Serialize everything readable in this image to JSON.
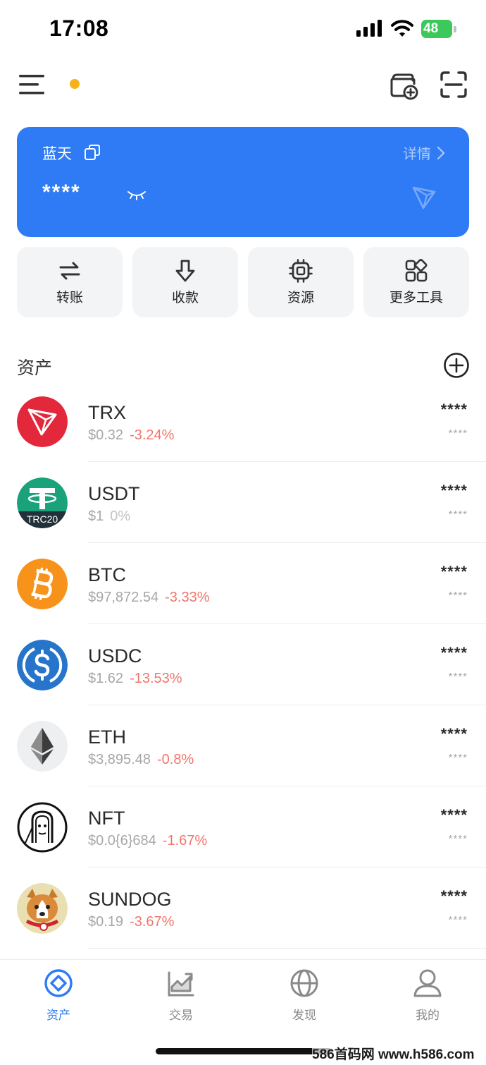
{
  "status_bar": {
    "time": "17:08",
    "battery": "48",
    "icons": [
      "cellular-signal-icon",
      "wifi-icon",
      "battery-charging-icon"
    ]
  },
  "top_bar": {
    "icons": [
      "menu-icon",
      "add-wallet-icon",
      "scan-icon"
    ],
    "dot_color": "#f5b21a"
  },
  "wallet": {
    "name": "蓝天",
    "detail_label": "详情",
    "balance": "****",
    "card_color": "#2f7bf5"
  },
  "actions": [
    {
      "label": "转账",
      "icon": "transfer-icon"
    },
    {
      "label": "收款",
      "icon": "receive-icon"
    },
    {
      "label": "资源",
      "icon": "resource-chip-icon"
    },
    {
      "label": "更多工具",
      "icon": "more-tools-icon"
    }
  ],
  "assets": {
    "title": "资产",
    "items": [
      {
        "symbol": "TRX",
        "price": "$0.32",
        "change": "-3.24%",
        "amount": "****",
        "value": "****",
        "logo": "trx-logo"
      },
      {
        "symbol": "USDT",
        "price": "$1",
        "change": "0%",
        "amount": "****",
        "value": "****",
        "logo": "usdt-logo",
        "badge": "TRC20"
      },
      {
        "symbol": "BTC",
        "price": "$97,872.54",
        "change": "-3.33%",
        "amount": "****",
        "value": "****",
        "logo": "btc-logo"
      },
      {
        "symbol": "USDC",
        "price": "$1.62",
        "change": "-13.53%",
        "amount": "****",
        "value": "****",
        "logo": "usdc-logo"
      },
      {
        "symbol": "ETH",
        "price": "$3,895.48",
        "change": "-0.8%",
        "amount": "****",
        "value": "****",
        "logo": "eth-logo"
      },
      {
        "symbol": "NFT",
        "price": "$0.0{6}684",
        "change": "-1.67%",
        "amount": "****",
        "value": "****",
        "logo": "nft-logo"
      },
      {
        "symbol": "SUNDOG",
        "price": "$0.19",
        "change": "-3.67%",
        "amount": "****",
        "value": "****",
        "logo": "sundog-logo"
      }
    ]
  },
  "bottom_nav": [
    {
      "label": "资产",
      "icon": "assets-icon",
      "active": true
    },
    {
      "label": "交易",
      "icon": "trade-chart-icon",
      "active": false
    },
    {
      "label": "发现",
      "icon": "globe-icon",
      "active": false
    },
    {
      "label": "我的",
      "icon": "profile-icon",
      "active": false
    }
  ],
  "watermark": "586首码网 www.h586.com",
  "colors": {
    "accent": "#2f7bf5",
    "negative": "#f0766c",
    "muted": "#a7a7a7"
  }
}
